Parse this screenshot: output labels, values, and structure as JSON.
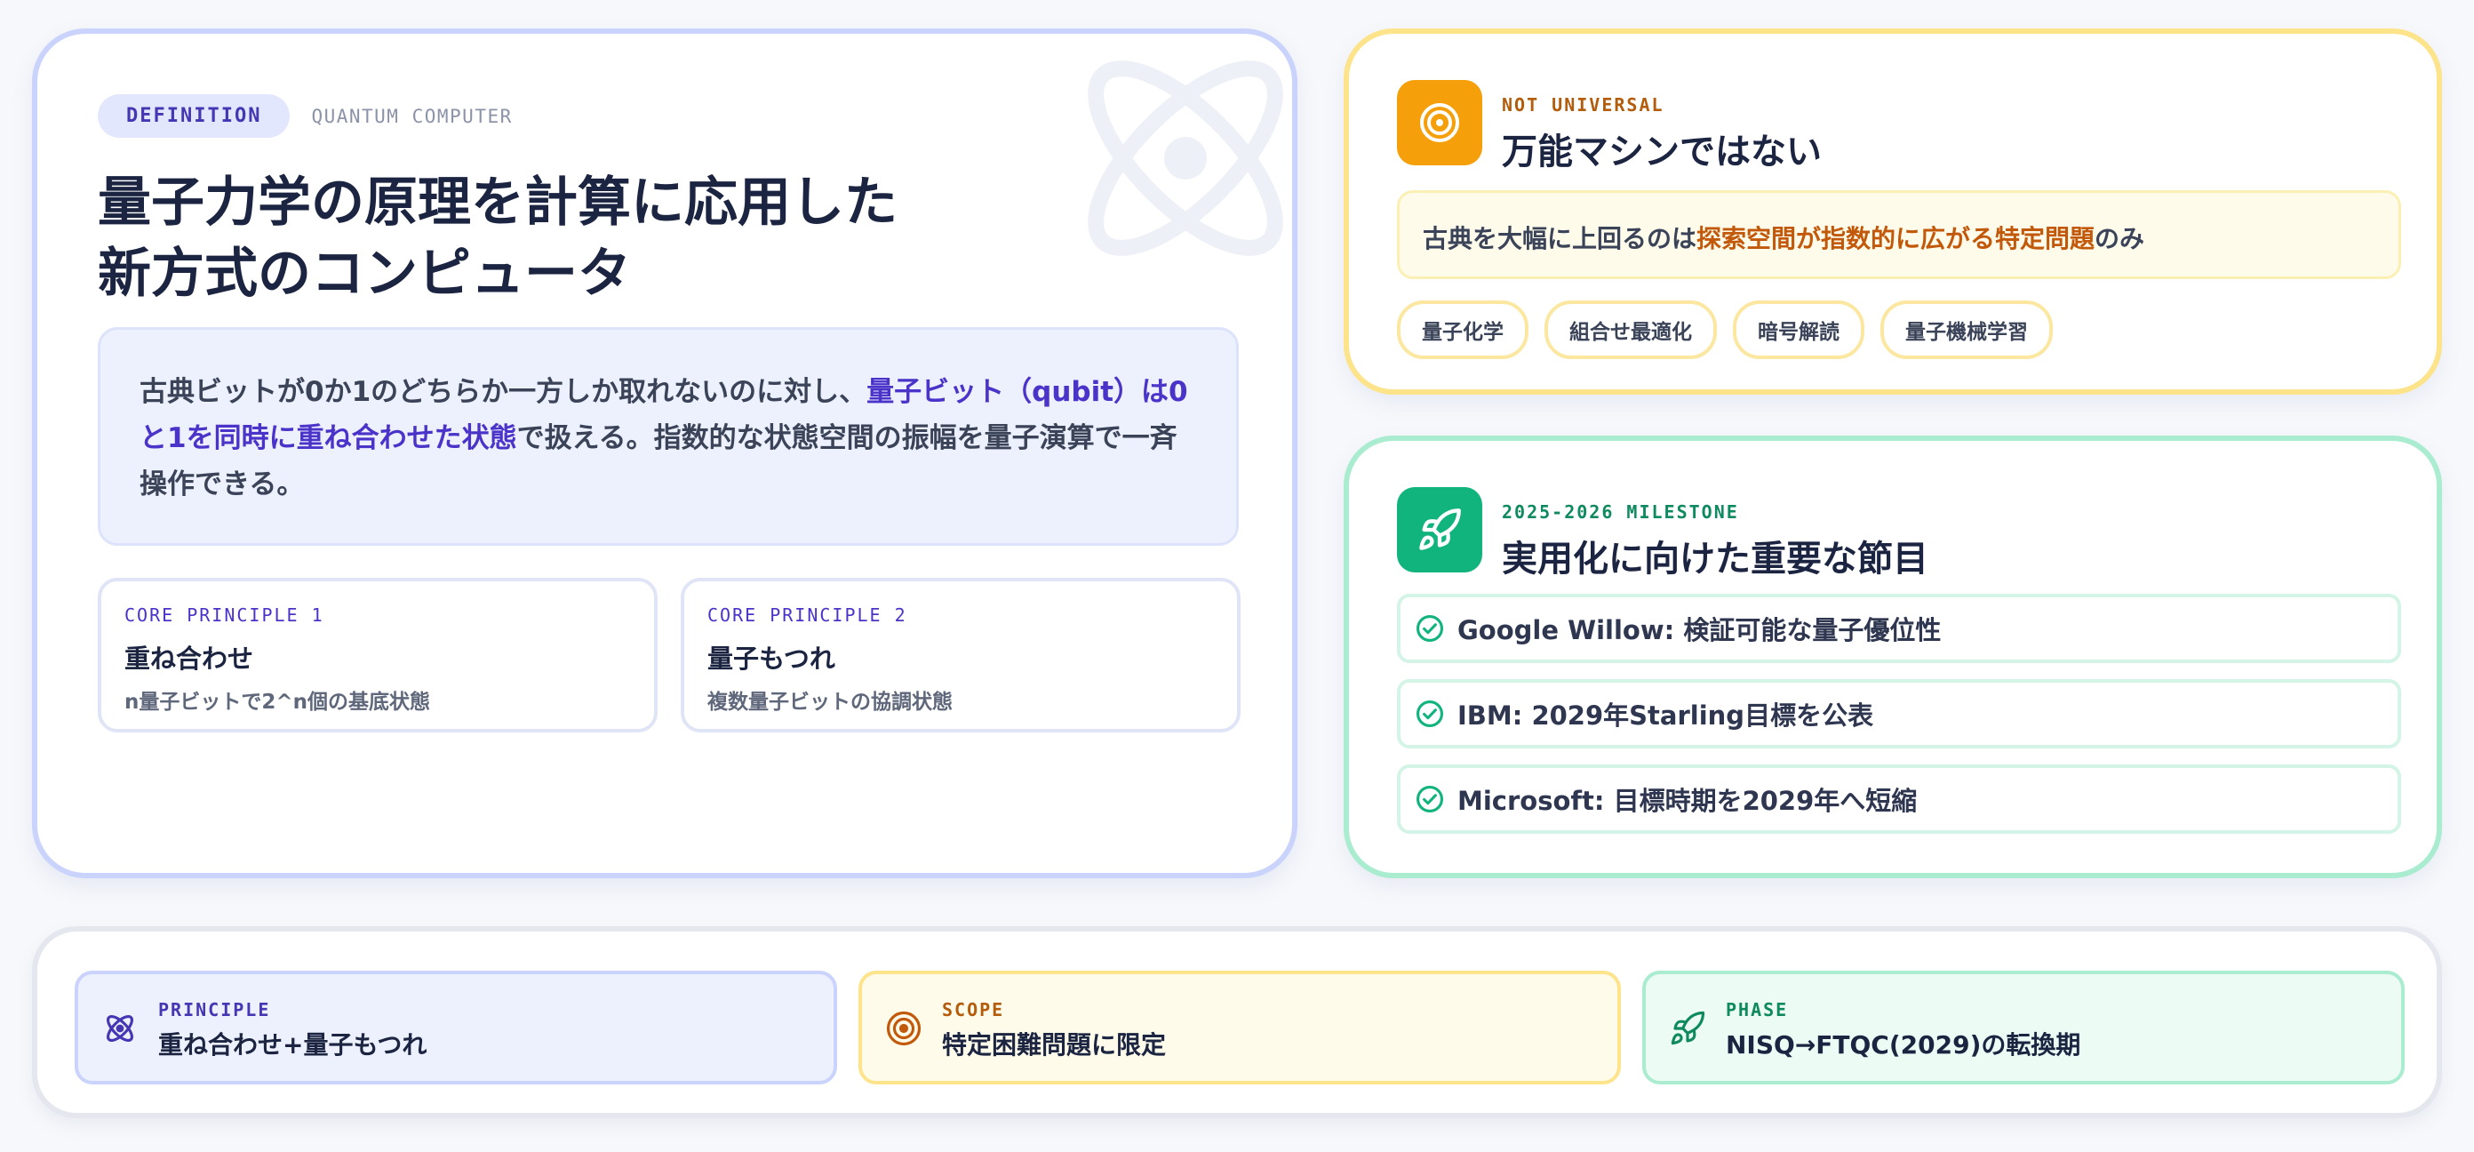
{
  "definition": {
    "tag": "DEFINITION",
    "subtitle": "QUANTUM COMPUTER",
    "title_line1": "量子力学の原理を計算に応用した",
    "title_line2": "新方式のコンピュータ",
    "desc_pre": "古典ビットが0か1のどちらか一方しか取れないのに対し、",
    "desc_highlight": "量子ビット（qubit）は0と1を同時に重ね合わせた状態",
    "desc_post": "で扱える。指数的な状態空間の振幅を量子演算で一斉操作できる。",
    "principles": [
      {
        "label": "CORE PRINCIPLE 1",
        "title": "重ね合わせ",
        "text": "n量子ビットで2^n個の基底状態"
      },
      {
        "label": "CORE PRINCIPLE 2",
        "title": "量子もつれ",
        "text": "複数量子ビットの協調状態"
      }
    ]
  },
  "universal": {
    "kicker": "NOT UNIVERSAL",
    "title": "万能マシンではない",
    "box_pre": "古典を大幅に上回るのは",
    "box_highlight": "探索空間が指数的に広がる特定問題",
    "box_post": "のみ",
    "chips": [
      "量子化学",
      "組合せ最適化",
      "暗号解読",
      "量子機械学習"
    ],
    "accent": "#f59f0b"
  },
  "milestone": {
    "kicker": "2025-2026 MILESTONE",
    "title": "実用化に向けた重要な節目",
    "items": [
      "Google Willow: 検証可能な量子優位性",
      "IBM: 2029年Starling目標を公表",
      "Microsoft: 目標時期を2029年へ短縮"
    ],
    "accent": "#12b47d"
  },
  "summary": [
    {
      "kicker": "PRINCIPLE",
      "value": "重ね合わせ+量子もつれ",
      "icon": "atom-icon"
    },
    {
      "kicker": "SCOPE",
      "value": "特定困難問題に限定",
      "icon": "target-icon"
    },
    {
      "kicker": "PHASE",
      "value": "NISQ→FTQC(2029)の転換期",
      "icon": "rocket-icon"
    }
  ]
}
